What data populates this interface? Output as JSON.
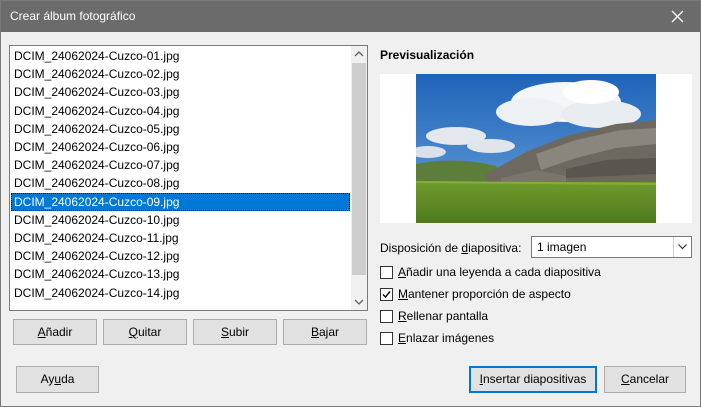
{
  "window": {
    "title": "Crear álbum fotográfico"
  },
  "files": {
    "items": [
      "DCIM_24062024-Cuzco-01.jpg",
      "DCIM_24062024-Cuzco-02.jpg",
      "DCIM_24062024-Cuzco-03.jpg",
      "DCIM_24062024-Cuzco-04.jpg",
      "DCIM_24062024-Cuzco-05.jpg",
      "DCIM_24062024-Cuzco-06.jpg",
      "DCIM_24062024-Cuzco-07.jpg",
      "DCIM_24062024-Cuzco-08.jpg",
      "DCIM_24062024-Cuzco-09.jpg",
      "DCIM_24062024-Cuzco-10.jpg",
      "DCIM_24062024-Cuzco-11.jpg",
      "DCIM_24062024-Cuzco-12.jpg",
      "DCIM_24062024-Cuzco-13.jpg",
      "DCIM_24062024-Cuzco-14.jpg"
    ],
    "selected_index": 8
  },
  "list_buttons": {
    "add": {
      "pre": "",
      "key": "A",
      "post": "ñadir"
    },
    "remove": {
      "pre": "",
      "key": "Q",
      "post": "uitar"
    },
    "up": {
      "pre": "",
      "key": "S",
      "post": "ubir"
    },
    "down": {
      "pre": "",
      "key": "B",
      "post": "ajar"
    }
  },
  "preview": {
    "title": "Previsualización"
  },
  "layout": {
    "label_pre": "Disposición de ",
    "label_key": "d",
    "label_post": "iapositiva:",
    "value": "1 imagen"
  },
  "options": [
    {
      "pre": "",
      "key": "A",
      "post": "ñadir una leyenda a cada diapositiva",
      "checked": false
    },
    {
      "pre": "",
      "key": "M",
      "post": "antener proporción de aspecto",
      "checked": true
    },
    {
      "pre": "",
      "key": "R",
      "post": "ellenar pantalla",
      "checked": false
    },
    {
      "pre": "",
      "key": "E",
      "post": "nlazar imágenes",
      "checked": false
    }
  ],
  "footer": {
    "help": {
      "pre": "Ay",
      "key": "u",
      "post": "da"
    },
    "insert": {
      "pre": "",
      "key": "I",
      "post": "nsertar diapositivas"
    },
    "cancel": {
      "pre": "",
      "key": "C",
      "post": "ancelar"
    }
  },
  "colors": {
    "titlebar": "#6b6b6b",
    "selection": "#0078d7"
  },
  "icons": {
    "close": "close-icon",
    "dropdown": "chevron-down-icon",
    "scroll_up": "arrow-up-icon",
    "scroll_down": "arrow-down-icon"
  }
}
